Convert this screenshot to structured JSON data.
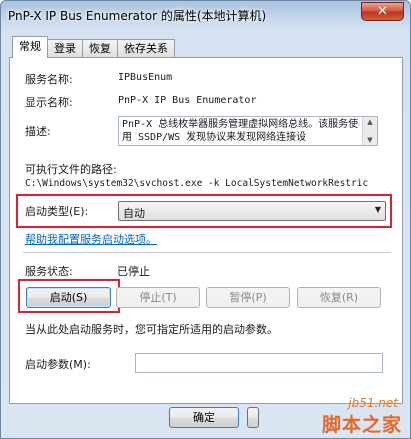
{
  "window": {
    "title": "PnP-X IP Bus Enumerator 的属性(本地计算机)",
    "close_glyph": "✕"
  },
  "tabs": [
    {
      "label": "常规",
      "active": true
    },
    {
      "label": "登录",
      "active": false
    },
    {
      "label": "恢复",
      "active": false
    },
    {
      "label": "依存关系",
      "active": false
    }
  ],
  "general": {
    "service_name_label": "服务名称:",
    "service_name": "IPBusEnum",
    "display_name_label": "显示名称:",
    "display_name": "PnP-X IP Bus Enumerator",
    "description_label": "描述:",
    "description": "PnP-X 总线枚举器服务管理虚拟网络总线。该服务使用 SSDP/WS 发现协议来发现网络连接设",
    "exe_path_label": "可执行文件的路径:",
    "exe_path": "C:\\Windows\\system32\\svchost.exe -k LocalSystemNetworkRestric",
    "startup_type_label": "启动类型(E):",
    "startup_type_value": "自动",
    "help_link": "帮助我配置服务启动选项。",
    "status_label": "服务状态:",
    "status_value": "已停止",
    "buttons": {
      "start": "启动(S)",
      "stop": "停止(T)",
      "pause": "暂停(P)",
      "resume": "恢复(R)"
    },
    "hint": "当从此处启动服务时，您可指定所适用的启动参数。",
    "start_params_label": "启动参数(M):",
    "start_params_value": ""
  },
  "footer": {
    "ok_label": "确定"
  },
  "watermark": {
    "site": "jb51.net",
    "name": "脚本之家"
  },
  "colors": {
    "highlight": "#d9232e",
    "link": "#0066cc",
    "watermark": "#e3692a"
  }
}
